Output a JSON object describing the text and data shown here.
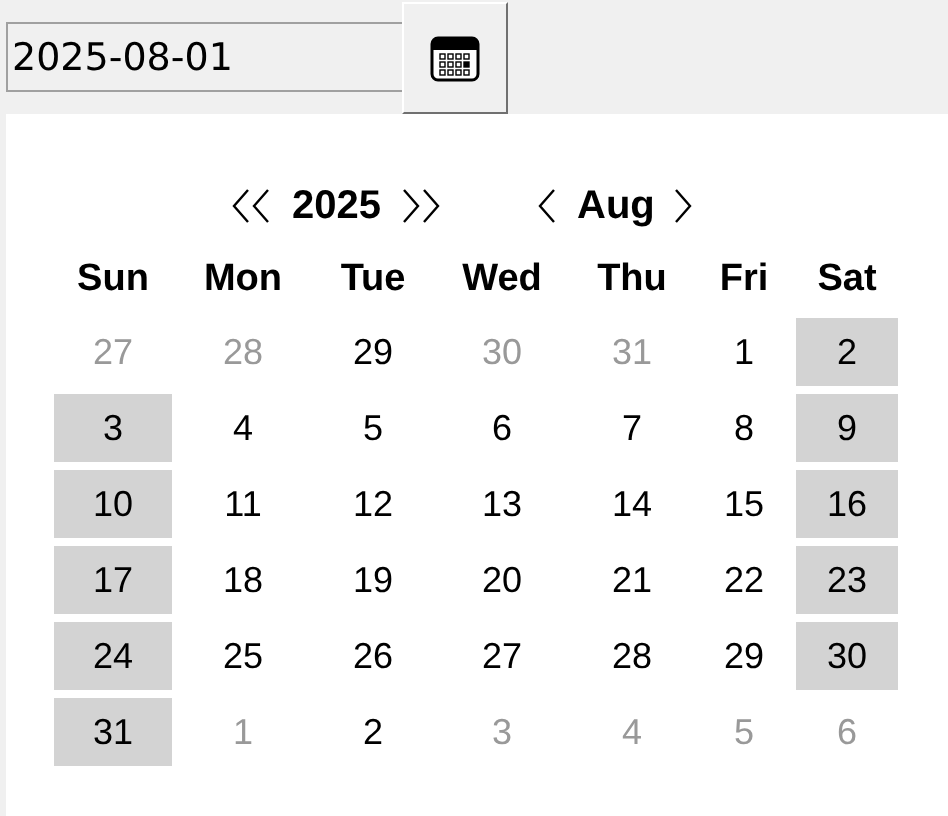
{
  "date_field": {
    "value": "2025-08-01"
  },
  "calendar": {
    "year": "2025",
    "month": "Aug",
    "weekdays": [
      "Sun",
      "Mon",
      "Tue",
      "Wed",
      "Thu",
      "Fri",
      "Sat"
    ],
    "weeks": [
      [
        {
          "day": "27",
          "muted": true,
          "highlighted": false
        },
        {
          "day": "28",
          "muted": true,
          "highlighted": false
        },
        {
          "day": "29",
          "muted": false,
          "highlighted": false
        },
        {
          "day": "30",
          "muted": true,
          "highlighted": false
        },
        {
          "day": "31",
          "muted": true,
          "highlighted": false
        },
        {
          "day": "1",
          "muted": false,
          "highlighted": false
        },
        {
          "day": "2",
          "muted": false,
          "highlighted": true
        }
      ],
      [
        {
          "day": "3",
          "muted": false,
          "highlighted": true
        },
        {
          "day": "4",
          "muted": false,
          "highlighted": false
        },
        {
          "day": "5",
          "muted": false,
          "highlighted": false
        },
        {
          "day": "6",
          "muted": false,
          "highlighted": false
        },
        {
          "day": "7",
          "muted": false,
          "highlighted": false
        },
        {
          "day": "8",
          "muted": false,
          "highlighted": false
        },
        {
          "day": "9",
          "muted": false,
          "highlighted": true
        }
      ],
      [
        {
          "day": "10",
          "muted": false,
          "highlighted": true
        },
        {
          "day": "11",
          "muted": false,
          "highlighted": false
        },
        {
          "day": "12",
          "muted": false,
          "highlighted": false
        },
        {
          "day": "13",
          "muted": false,
          "highlighted": false
        },
        {
          "day": "14",
          "muted": false,
          "highlighted": false
        },
        {
          "day": "15",
          "muted": false,
          "highlighted": false
        },
        {
          "day": "16",
          "muted": false,
          "highlighted": true
        }
      ],
      [
        {
          "day": "17",
          "muted": false,
          "highlighted": true
        },
        {
          "day": "18",
          "muted": false,
          "highlighted": false
        },
        {
          "day": "19",
          "muted": false,
          "highlighted": false
        },
        {
          "day": "20",
          "muted": false,
          "highlighted": false
        },
        {
          "day": "21",
          "muted": false,
          "highlighted": false
        },
        {
          "day": "22",
          "muted": false,
          "highlighted": false
        },
        {
          "day": "23",
          "muted": false,
          "highlighted": true
        }
      ],
      [
        {
          "day": "24",
          "muted": false,
          "highlighted": true
        },
        {
          "day": "25",
          "muted": false,
          "highlighted": false
        },
        {
          "day": "26",
          "muted": false,
          "highlighted": false
        },
        {
          "day": "27",
          "muted": false,
          "highlighted": false
        },
        {
          "day": "28",
          "muted": false,
          "highlighted": false
        },
        {
          "day": "29",
          "muted": false,
          "highlighted": false
        },
        {
          "day": "30",
          "muted": false,
          "highlighted": true
        }
      ],
      [
        {
          "day": "31",
          "muted": false,
          "highlighted": true
        },
        {
          "day": "1",
          "muted": true,
          "highlighted": false
        },
        {
          "day": "2",
          "muted": false,
          "highlighted": false
        },
        {
          "day": "3",
          "muted": true,
          "highlighted": false
        },
        {
          "day": "4",
          "muted": true,
          "highlighted": false
        },
        {
          "day": "5",
          "muted": true,
          "highlighted": false
        },
        {
          "day": "6",
          "muted": true,
          "highlighted": false
        }
      ]
    ]
  }
}
